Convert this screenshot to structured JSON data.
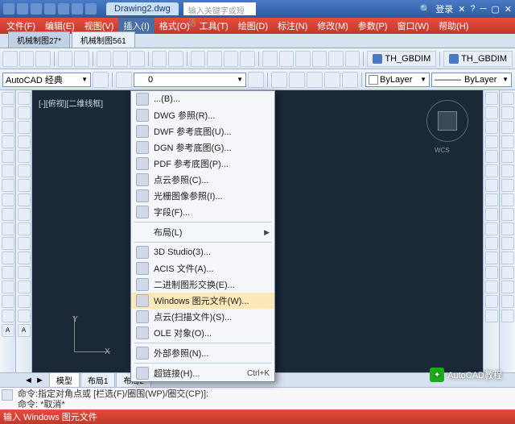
{
  "title": {
    "doc": "Drawing2.dwg",
    "search_ph": "输入关键字或短语",
    "login": "登录"
  },
  "menu": {
    "items": [
      "文件(F)",
      "编辑(E)",
      "视图(V)",
      "插入(I)",
      "格式(O)",
      "工具(T)",
      "绘图(D)",
      "标注(N)",
      "修改(M)",
      "参数(P)",
      "窗口(W)",
      "帮助(H)"
    ]
  },
  "filetabs": {
    "t1": "机械制图27*",
    "t2": "机械制图561"
  },
  "workspace": {
    "label": "AutoCAD 经典"
  },
  "layer": {
    "bylayer": "ByLayer",
    "bylayer2": "ByLayer"
  },
  "th": {
    "b1": "TH_GBDIM",
    "b2": "TH_GBDIM"
  },
  "viewport": {
    "label": "[-][俯视][二维线框]",
    "wcs": "WCS",
    "y": "Y",
    "x": "X"
  },
  "dropdown": {
    "i0": "...(B)...",
    "i1": "DWG 参照(R)...",
    "i2": "DWF 参考底图(U)...",
    "i3": "DGN 参考底图(G)...",
    "i4": "PDF 参考底图(P)...",
    "i5": "点云参照(C)...",
    "i6": "光栅图像参照(I)...",
    "i7": "字段(F)...",
    "i8": "布局(L)",
    "i9": "3D Studio(3)...",
    "i10": "ACIS 文件(A)...",
    "i11": "二进制图形交换(E)...",
    "i12": "Windows 图元文件(W)...",
    "i13": "点云(扫描文件)(S)...",
    "i14": "OLE 对象(O)...",
    "i15": "外部参照(N)...",
    "i16": "超链接(H)...",
    "sc16": "Ctrl+K"
  },
  "btabs": {
    "t0": "模型",
    "t1": "布局1",
    "t2": "布局2"
  },
  "cmd": {
    "l1": "命令:指定对角点或 [栏选(F)/圈围(WP)/圈交(CP)]:",
    "l2": "命令: *取消*"
  },
  "status": {
    "txt": "输入 Windows 图元文件"
  },
  "watermark": {
    "txt": "AutoCAD教程"
  }
}
